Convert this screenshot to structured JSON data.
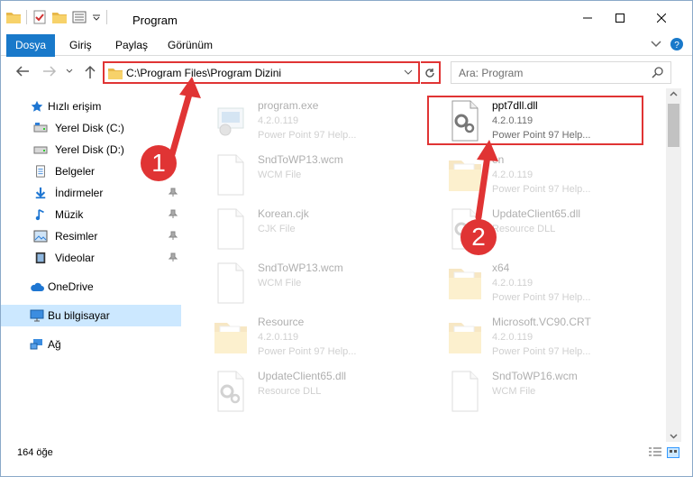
{
  "window": {
    "title": "Program",
    "qat_icons": [
      "folder-icon",
      "properties-check-icon",
      "new-folder-icon",
      "view-options-icon",
      "customize-qat-icon"
    ]
  },
  "ribbon": {
    "tabs": [
      {
        "label": "Dosya"
      },
      {
        "label": "Giriş"
      },
      {
        "label": "Paylaş"
      },
      {
        "label": "Görünüm"
      }
    ],
    "file_tab_color": "#1979ca"
  },
  "address": {
    "path": "C:\\Program Files\\Program Dizini",
    "search_placeholder": "Ara: Program"
  },
  "sidebar": {
    "items": [
      {
        "label": "Hızlı erişim",
        "icon": "star-icon"
      },
      {
        "label": "Yerel Disk (C:)",
        "icon": "drive-icon"
      },
      {
        "label": "Yerel Disk (D:)",
        "icon": "drive-icon"
      },
      {
        "label": "Belgeler",
        "icon": "documents-icon"
      },
      {
        "label": "İndirmeler",
        "icon": "download-icon"
      },
      {
        "label": "Müzik",
        "icon": "music-icon"
      },
      {
        "label": "Resimler",
        "icon": "pictures-icon"
      },
      {
        "label": "Videolar",
        "icon": "videos-icon"
      },
      {
        "label": "OneDrive",
        "icon": "cloud-icon"
      },
      {
        "label": "Bu bilgisayar",
        "icon": "computer-icon"
      },
      {
        "label": "Ağ",
        "icon": "network-icon"
      }
    ],
    "selected": "Bu bilgisayar"
  },
  "files": [
    {
      "name": "program.exe",
      "meta1": "4.2.0.119",
      "meta2": "Power Point 97 Help...",
      "type": "exe"
    },
    {
      "name": "ppt7dll.dll",
      "meta1": "4.2.0.119",
      "meta2": "Power Point 97 Help...",
      "type": "dll"
    },
    {
      "name": "SndToWP13.wcm",
      "meta1": "WCM File",
      "meta2": "",
      "type": "doc"
    },
    {
      "name": "en",
      "meta1": "4.2.0.119",
      "meta2": "Power Point 97 Help...",
      "type": "folder"
    },
    {
      "name": "Korean.cjk",
      "meta1": "CJK File",
      "meta2": "",
      "type": "doc"
    },
    {
      "name": "UpdateClient65.dll",
      "meta1": "Resource DLL",
      "meta2": "",
      "type": "dll"
    },
    {
      "name": "SndToWP13.wcm",
      "meta1": "WCM File",
      "meta2": "",
      "type": "doc"
    },
    {
      "name": "x64",
      "meta1": "4.2.0.119",
      "meta2": "Power Point 97 Help...",
      "type": "folder"
    },
    {
      "name": "Resource",
      "meta1": "4.2.0.119",
      "meta2": "Power Point 97 Help...",
      "type": "folder"
    },
    {
      "name": "Microsoft.VC90.CRT",
      "meta1": "4.2.0.119",
      "meta2": "Power Point 97 Help...",
      "type": "folder"
    },
    {
      "name": "UpdateClient65.dll",
      "meta1": "Resource DLL",
      "meta2": "",
      "type": "dll"
    },
    {
      "name": "SndToWP16.wcm",
      "meta1": "WCM File",
      "meta2": "",
      "type": "doc"
    }
  ],
  "status": {
    "count": "164 öğe"
  },
  "annotations": {
    "callout1": "1",
    "callout2": "2",
    "color": "#e03434"
  }
}
